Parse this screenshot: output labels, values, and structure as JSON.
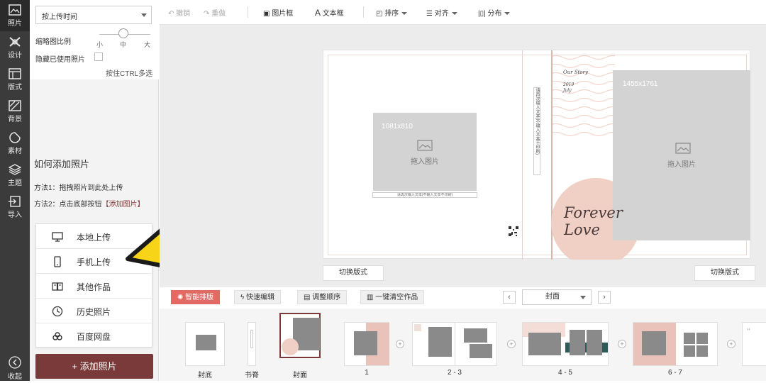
{
  "rail": {
    "items": [
      {
        "label": "照片",
        "icon": "image-icon"
      },
      {
        "label": "设计",
        "icon": "design-icon"
      },
      {
        "label": "版式",
        "icon": "layout-icon"
      },
      {
        "label": "背景",
        "icon": "background-icon"
      },
      {
        "label": "素材",
        "icon": "sticker-icon"
      },
      {
        "label": "主题",
        "icon": "layers-icon"
      },
      {
        "label": "导入",
        "icon": "import-icon"
      }
    ],
    "collapse": "收起"
  },
  "panel": {
    "sort_value": "按上传时间",
    "thumb_ratio_label": "缩略图比例",
    "size_small": "小",
    "size_medium": "中",
    "size_large": "大",
    "hide_used_label": "隐藏已使用照片",
    "ctrl_hint": "按住CTRL多选",
    "howto_title": "如何添加照片",
    "method1": "方法1：拖拽照片到此处上传",
    "method2_prefix": "方法2：点击底部按钮",
    "method2_link": "【添加图片】",
    "upload_menu": [
      {
        "label": "本地上传",
        "icon": "monitor-icon"
      },
      {
        "label": "手机上传",
        "icon": "phone-icon"
      },
      {
        "label": "其他作品",
        "icon": "book-icon"
      },
      {
        "label": "历史照片",
        "icon": "clock-icon"
      },
      {
        "label": "百度网盘",
        "icon": "cloud-icon"
      }
    ],
    "add_photo": "+ 添加照片"
  },
  "toolbar": {
    "undo": "撤销",
    "redo": "重做",
    "photo_frame": "图片框",
    "text_box": "文本框",
    "arrange": "排序",
    "align": "对齐",
    "distribute": "分布"
  },
  "canvas": {
    "left_photo_size": "1081x810",
    "insert_photo": "拖入图片",
    "left_caption": "请再次输入文本(不输入文本不印刷)",
    "spine_text": "请再次输入文本(不输入文本不印刷)",
    "story_title": "Our Story",
    "story_year": "2019",
    "story_month": "July",
    "right_photo_size": "1455x1761",
    "forever": "Forever",
    "love": "Love",
    "switch_layout_left": "切换版式",
    "switch_layout_right": "切换版式"
  },
  "bottom": {
    "smart_layout": "智能排版",
    "quick_edit": "快速编辑",
    "reorder": "调整顺序",
    "clear_all": "一键清空作品",
    "page_value": "封面",
    "prev": "‹",
    "next": "›"
  },
  "thumbs": {
    "labels": [
      "封底",
      "书脊",
      "封面",
      "1",
      "2 - 3",
      "4 - 5",
      "6 - 7"
    ]
  },
  "colors": {
    "rail_bg": "#3b3b3b",
    "accent_red": "#e26a62",
    "brand_dark_red": "#7b3a3a",
    "pink": "#f0d0c8"
  }
}
